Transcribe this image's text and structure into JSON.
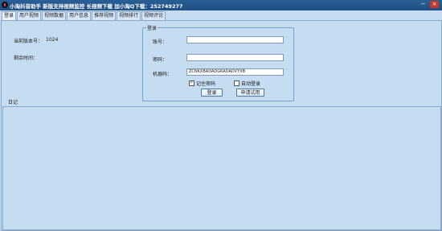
{
  "window": {
    "title": "小淘抖音助手 新版支持视频监控 长视频下载 加小淘Q下载：252749277",
    "minimize_glyph": "−",
    "close_glyph": "×"
  },
  "tabs": [
    {
      "label": "登录"
    },
    {
      "label": "用户视频"
    },
    {
      "label": "视频数据"
    },
    {
      "label": "用户信息"
    },
    {
      "label": "推荐视频"
    },
    {
      "label": "视频排行"
    },
    {
      "label": "视频评论"
    }
  ],
  "info": {
    "version_label": "当前版本号：",
    "version_value": "1024",
    "remaining_label": "剩余时间："
  },
  "login": {
    "group_title": "登录",
    "account_label": "账号：",
    "account_value": "",
    "password_label": "密码：",
    "password_value": "",
    "machine_label": "机器码：",
    "machine_value": "ZCNKXBADADGKADADVYXB",
    "remember_label": "记住密码",
    "remember_checked": true,
    "auto_login_label": "自动登录",
    "auto_login_checked": false,
    "login_button": "登录",
    "trial_button": "申请试用"
  },
  "log": {
    "label": "日记",
    "content": ""
  },
  "icons": {
    "app": "douyin-app-icon",
    "check": "checkmark-icon"
  }
}
